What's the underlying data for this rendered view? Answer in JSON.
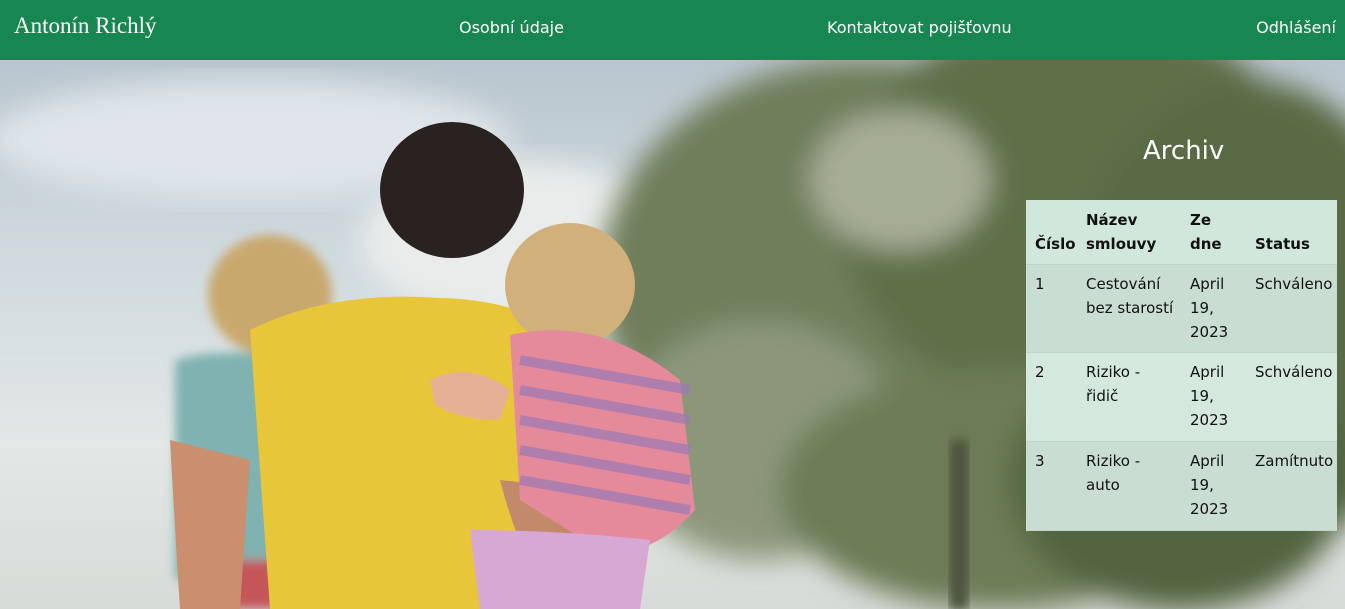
{
  "navbar": {
    "brand": "Antonín Richlý",
    "links": {
      "personal": "Osobní údaje",
      "contact": "Kontaktovat pojišťovnu",
      "logout": "Odhlášení"
    },
    "background_color": "#188650"
  },
  "archive": {
    "title": "Archiv",
    "columns": [
      "Číslo",
      "Název smlouvy",
      "Ze dne",
      "Status"
    ],
    "rows": [
      {
        "number": "1",
        "name": "Cestování bez starostí",
        "date": "April 19, 2023",
        "status": "Schváleno"
      },
      {
        "number": "2",
        "name": "Riziko - řidič",
        "date": "April 19, 2023",
        "status": "Schváleno"
      },
      {
        "number": "3",
        "name": "Riziko - auto",
        "date": "April 19, 2023",
        "status": "Zamítnuto"
      }
    ]
  }
}
